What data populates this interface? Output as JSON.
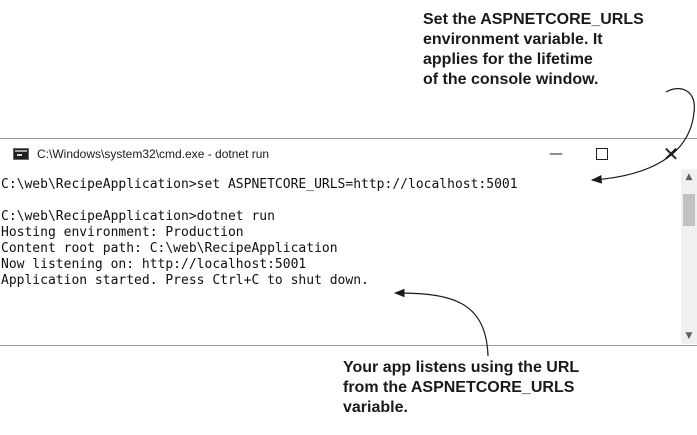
{
  "callouts": {
    "top": {
      "lines": [
        "Set the ASPNETCORE_URLS",
        "environment variable. It",
        "applies for the lifetime",
        "of the console window."
      ]
    },
    "bottom": {
      "lines": [
        "Your app listens using the URL",
        "from the ASPNETCORE_URLS",
        "variable."
      ]
    }
  },
  "window": {
    "title": "C:\\Windows\\system32\\cmd.exe - dotnet  run",
    "icon": "console-app-icon",
    "controls": {
      "minimize": "—",
      "close": "✕"
    }
  },
  "console": {
    "lines": [
      "C:\\web\\RecipeApplication>set ASPNETCORE_URLS=http://localhost:5001",
      "C:\\web\\RecipeApplication>dotnet run",
      "Hosting environment: Production",
      "Content root path: C:\\web\\RecipeApplication",
      "Now listening on: http://localhost:5001",
      "Application started. Press Ctrl+C to shut down."
    ]
  },
  "scrollbar": {
    "up_arrow": "▲",
    "down_arrow": "▼"
  }
}
